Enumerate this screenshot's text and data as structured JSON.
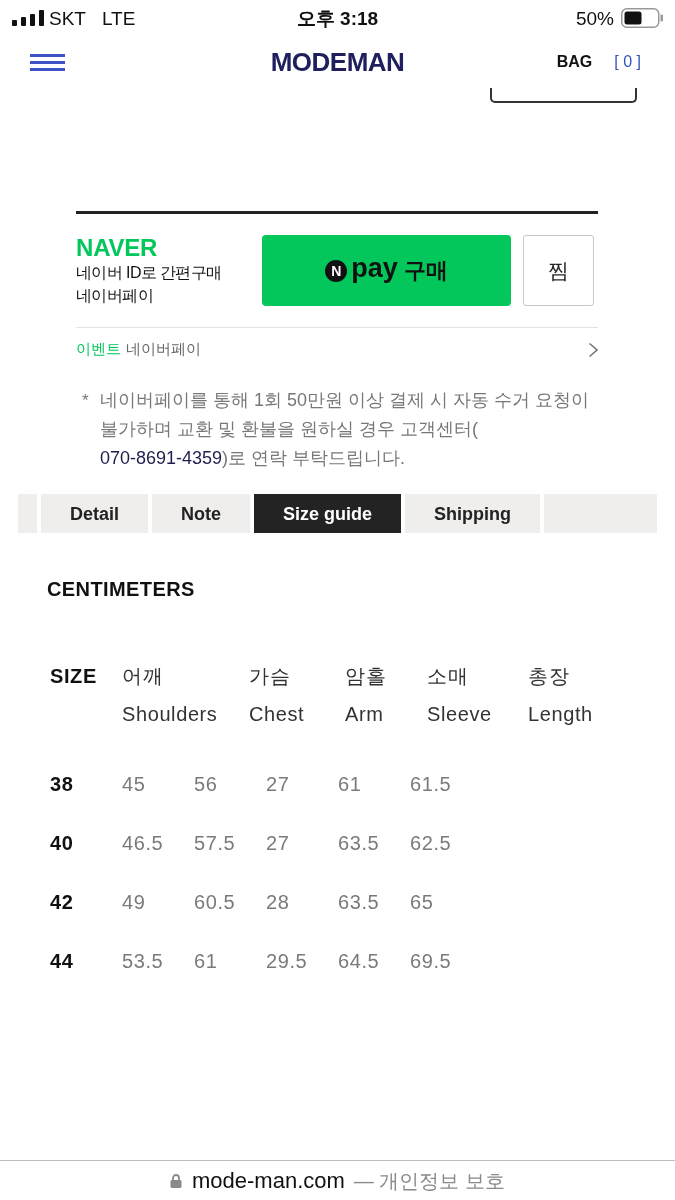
{
  "status_bar": {
    "carrier": "SKT",
    "network": "LTE",
    "time": "오후 3:18",
    "battery": "50%"
  },
  "header": {
    "logo": "MODEMAN",
    "bag_label": "BAG",
    "bag_count": "[ 0 ]"
  },
  "naver_pay": {
    "brand": "NAVER",
    "lines": [
      "네이버 ID로 간편구매",
      "네이버페이"
    ],
    "buy_button": {
      "logo_letter": "N",
      "pay": "pay",
      "label": "구매"
    },
    "wish_button": "찜",
    "event": {
      "tag": "이벤트",
      "title": "네이버페이"
    }
  },
  "notice": {
    "marker": "*",
    "lines": [
      "네이버페이를 통해 1회 50만원 이상 결제 시 자동 수거 요청이",
      "불가하며 교환 및 환불을 원하실 경우 고객센터("
    ],
    "phone": "070-8691-4359",
    "text_after": ")로 연락 부탁드립니다."
  },
  "tabs": [
    {
      "kind": "blank",
      "selected": false
    },
    {
      "kind": "label",
      "label": "Detail",
      "selected": false
    },
    {
      "kind": "label",
      "label": "Note",
      "selected": false
    },
    {
      "kind": "label",
      "label": "Size guide",
      "selected": true
    },
    {
      "kind": "label",
      "label": "Shipping",
      "selected": false
    },
    {
      "kind": "blank",
      "selected": false
    }
  ],
  "size_guide": {
    "unit": "CENTIMETERS",
    "size_header": "SIZE",
    "columns": [
      {
        "korean": "어깨",
        "english": "Shoulders"
      },
      {
        "korean": "가슴",
        "english": "Chest"
      },
      {
        "korean": "암홀",
        "english": "Arm"
      },
      {
        "korean": "소매",
        "english": "Sleeve"
      },
      {
        "korean": "총장",
        "english": "Length"
      }
    ],
    "rows": [
      {
        "size": "38",
        "values": [
          "45",
          "56",
          "27",
          "61",
          "61.5"
        ]
      },
      {
        "size": "40",
        "values": [
          "46.5",
          "57.5",
          "27",
          "63.5",
          "62.5"
        ]
      },
      {
        "size": "42",
        "values": [
          "49",
          "60.5",
          "28",
          "63.5",
          "65"
        ]
      },
      {
        "size": "44",
        "values": [
          "53.5",
          "61",
          "29.5",
          "64.5",
          "69.5"
        ]
      }
    ]
  },
  "browser_bar": {
    "domain": "mode-man.com",
    "note": "— 개인정보 보호"
  }
}
